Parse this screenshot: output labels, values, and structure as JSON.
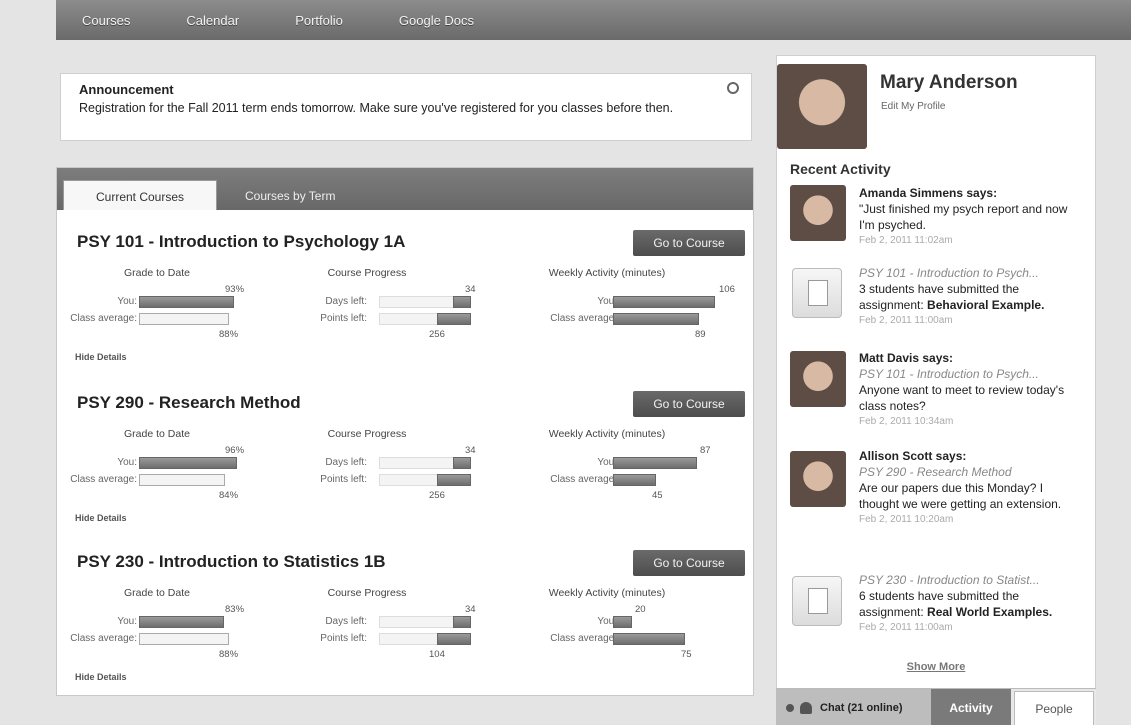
{
  "nav": [
    "Courses",
    "Calendar",
    "Portfolio",
    "Google Docs"
  ],
  "announcement": {
    "title": "Announcement",
    "text": "Registration for the Fall 2011 term ends tomorrow. Make sure you've registered for you classes before then."
  },
  "tabs": {
    "current": "Current Courses",
    "by_term": "Courses by Term"
  },
  "labels": {
    "go": "Go to Course",
    "grade": "Grade to Date",
    "progress": "Course Progress",
    "activity": "Weekly Activity (minutes)",
    "you": "You:",
    "class_avg": "Class average:",
    "days_left": "Days left:",
    "points_left": "Points left:",
    "hide": "Hide Details"
  },
  "courses": [
    {
      "title": "PSY 101 - Introduction to Psychology 1A",
      "grade_you": "93%",
      "grade_avg": "88%",
      "grade_you_frac": 0.93,
      "grade_avg_frac": 0.88,
      "days": "34",
      "points": "256",
      "act_you": "106",
      "act_avg": "89",
      "act_you_frac": 1.0,
      "act_avg_frac": 0.84
    },
    {
      "title": "PSY 290 - Research Method",
      "grade_you": "96%",
      "grade_avg": "84%",
      "grade_you_frac": 0.96,
      "grade_avg_frac": 0.84,
      "days": "34",
      "points": "256",
      "act_you": "87",
      "act_avg": "45",
      "act_you_frac": 0.82,
      "act_avg_frac": 0.42
    },
    {
      "title": "PSY 230 - Introduction to Statistics 1B",
      "grade_you": "83%",
      "grade_avg": "88%",
      "grade_you_frac": 0.83,
      "grade_avg_frac": 0.88,
      "days": "34",
      "points": "104",
      "act_you": "20",
      "act_avg": "75",
      "act_you_frac": 0.19,
      "act_avg_frac": 0.71
    }
  ],
  "profile": {
    "name": "Mary Anderson",
    "edit": "Edit My Profile"
  },
  "recent_title": "Recent Activity",
  "activity": [
    {
      "who": "Amanda Simmens says:",
      "text": "\"Just finished my psych report and now I'm psyched.",
      "time": "Feb 2, 2011 11:02am"
    },
    {
      "course": "PSY 101 - Introduction to Psych...",
      "text": "3 students have submitted the assignment: ",
      "bold": "Behavioral Example.",
      "time": "Feb 2, 2011 11:00am"
    },
    {
      "who": "Matt Davis says:",
      "course": "PSY 101 - Introduction to Psych...",
      "text": "Anyone want to meet to review today's class notes?",
      "time": "Feb 2, 2011 10:34am"
    },
    {
      "who": "Allison Scott says:",
      "course": "PSY 290 - Research Method",
      "text": "Are our papers due this Monday? I thought we were getting an extension.",
      "time": "Feb 2, 2011 10:20am"
    },
    {
      "course": "PSY 230 - Introduction to Statist...",
      "text": "6 students have submitted the assignment: ",
      "bold": "Real World Examples.",
      "time": "Feb 2, 2011 11:00am"
    }
  ],
  "show_more": "Show More",
  "bottom": {
    "chat": "Chat (21 online)",
    "activity": "Activity",
    "people": "People"
  }
}
